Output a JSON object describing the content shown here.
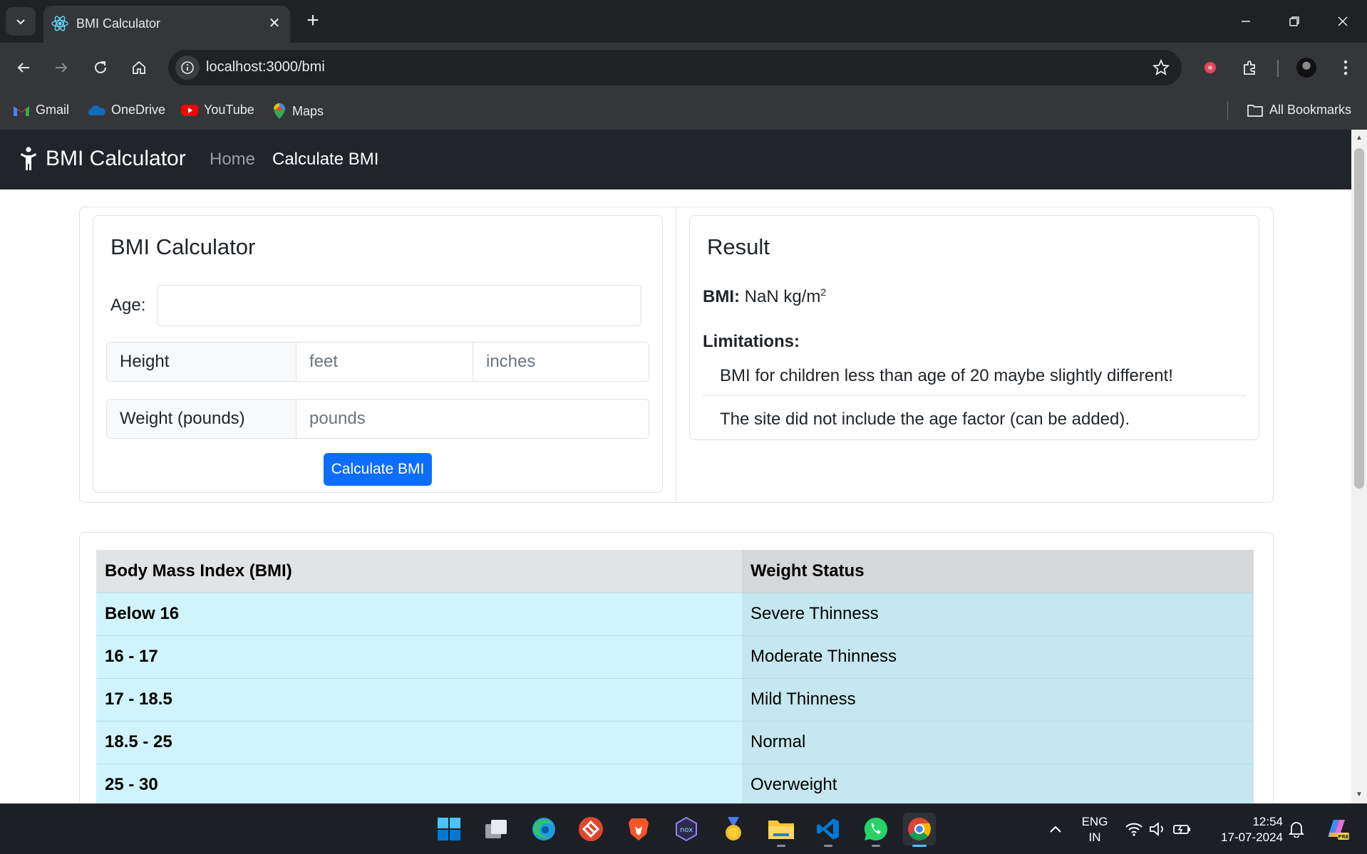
{
  "browser": {
    "tab_title": "BMI Calculator",
    "url": "localhost:3000/bmi",
    "bookmarks": [
      {
        "label": "Gmail",
        "icon": "gmail-icon"
      },
      {
        "label": "OneDrive",
        "icon": "onedrive-icon"
      },
      {
        "label": "YouTube",
        "icon": "youtube-icon"
      },
      {
        "label": "Maps",
        "icon": "maps-icon"
      }
    ],
    "all_bookmarks": "All Bookmarks"
  },
  "navbar": {
    "brand": "BMI Calculator",
    "links": [
      {
        "label": "Home",
        "active": false
      },
      {
        "label": "Calculate BMI",
        "active": true
      }
    ]
  },
  "calculator": {
    "title": "BMI Calculator",
    "age_label": "Age:",
    "age_value": "",
    "height_label": "Height",
    "feet_placeholder": "feet",
    "inches_placeholder": "inches",
    "weight_label": "Weight (pounds)",
    "pounds_placeholder": "pounds",
    "submit_label": "Calculate BMI"
  },
  "result": {
    "title": "Result",
    "bmi_label": "BMI:",
    "bmi_value": "NaN kg/m",
    "bmi_unit_sup": "2",
    "limitations_label": "Limitations:",
    "limitations": [
      "BMI for children less than age of 20 maybe slightly different!",
      "The site did not include the age factor (can be added)."
    ]
  },
  "bmi_table": {
    "headers": [
      "Body Mass Index (BMI)",
      "Weight Status"
    ],
    "rows": [
      [
        "Below 16",
        "Severe Thinness"
      ],
      [
        "16 - 17",
        "Moderate Thinness"
      ],
      [
        "17 - 18.5",
        "Mild Thinness"
      ],
      [
        "18.5 - 25",
        "Normal"
      ],
      [
        "25 - 30",
        "Overweight"
      ]
    ]
  },
  "taskbar": {
    "language": "ENG",
    "region": "IN",
    "time": "12:54",
    "date": "17-07-2024",
    "apps": [
      "windows-start-icon",
      "task-view-icon",
      "edge-icon",
      "anydesk-icon",
      "brave-icon",
      "nox-icon",
      "medal-icon",
      "file-explorer-icon",
      "vscode-icon",
      "whatsapp-icon",
      "chrome-icon"
    ]
  },
  "colors": {
    "navbar_bg": "#212529",
    "primary_button": "#0d6efd",
    "table_info_row": "#cff4fc",
    "table_header": "#e2e3e5"
  }
}
